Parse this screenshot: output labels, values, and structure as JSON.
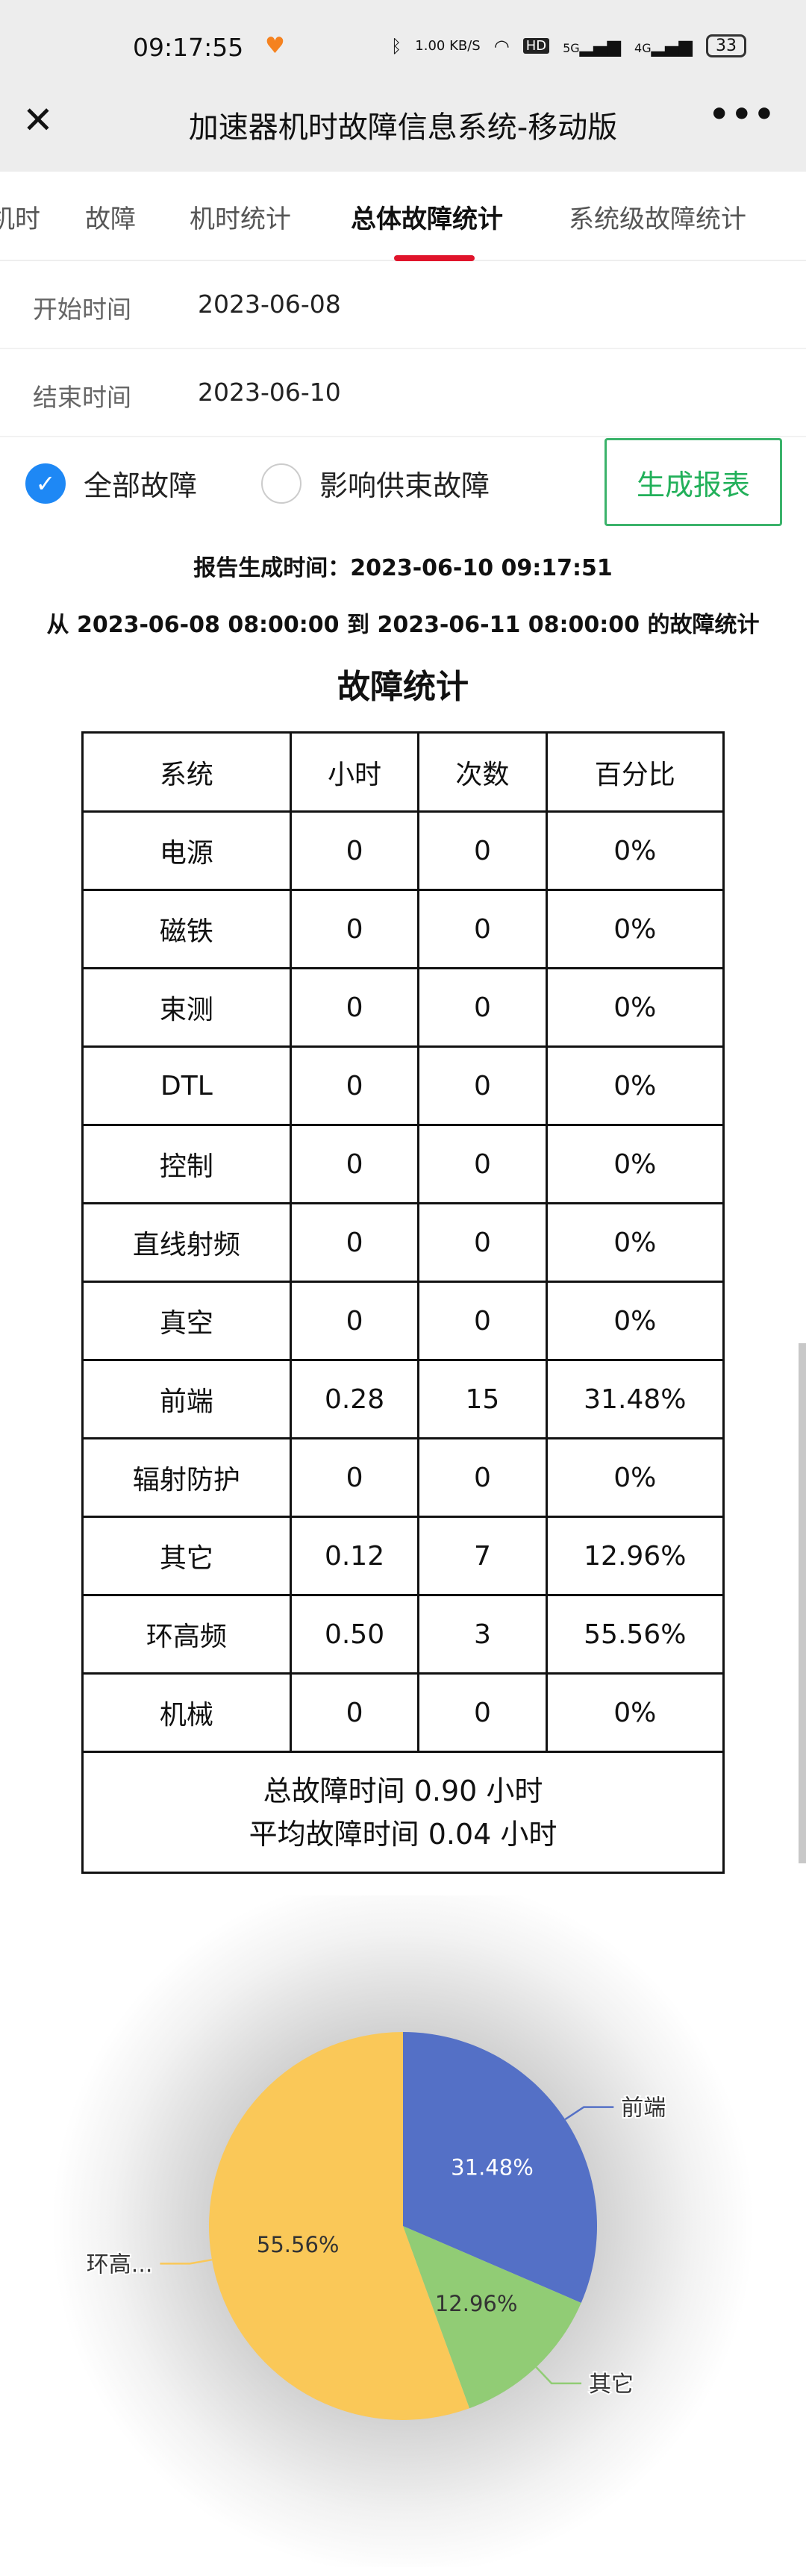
{
  "status_bar": {
    "time": "09:17:55",
    "net_speed": "1.00 KB/S",
    "network1": "5G",
    "network2": "4G",
    "battery": "33"
  },
  "header": {
    "title": "加速器机时故障信息系统-移动版"
  },
  "tabs": [
    {
      "label": "机时",
      "active": false
    },
    {
      "label": "故障",
      "active": false
    },
    {
      "label": "机时统计",
      "active": false
    },
    {
      "label": "总体故障统计",
      "active": true
    },
    {
      "label": "系统级故障统计",
      "active": false
    }
  ],
  "form": {
    "start_label": "开始时间",
    "start_value": "2023-06-08",
    "end_label": "结束时间",
    "end_value": "2023-06-10",
    "filter_all": "全部故障",
    "filter_all_checked": true,
    "filter_beam": "影响供束故障",
    "filter_beam_checked": false,
    "generate_button": "生成报表"
  },
  "report": {
    "generated_time": "报告生成时间：2023-06-10 09:17:51",
    "range": "从 2023-06-08 08:00:00 到 2023-06-11 08:00:00 的故障统计",
    "table_title": "故障统计"
  },
  "table": {
    "headers": [
      "系统",
      "小时",
      "次数",
      "百分比"
    ],
    "rows": [
      [
        "电源",
        "0",
        "0",
        "0%"
      ],
      [
        "磁铁",
        "0",
        "0",
        "0%"
      ],
      [
        "束测",
        "0",
        "0",
        "0%"
      ],
      [
        "DTL",
        "0",
        "0",
        "0%"
      ],
      [
        "控制",
        "0",
        "0",
        "0%"
      ],
      [
        "直线射频",
        "0",
        "0",
        "0%"
      ],
      [
        "真空",
        "0",
        "0",
        "0%"
      ],
      [
        "前端",
        "0.28",
        "15",
        "31.48%"
      ],
      [
        "辐射防护",
        "0",
        "0",
        "0%"
      ],
      [
        "其它",
        "0.12",
        "7",
        "12.96%"
      ],
      [
        "环高频",
        "0.50",
        "3",
        "55.56%"
      ],
      [
        "机械",
        "0",
        "0",
        "0%"
      ]
    ],
    "total": "总故障时间 0.90 小时",
    "average": "平均故障时间 0.04 小时"
  },
  "chart_data": {
    "type": "pie",
    "slices": [
      {
        "name": "前端",
        "label": "前端",
        "value": 31.48,
        "value_label": "31.48%",
        "color": "#5470c6",
        "text_color": "#ffffff"
      },
      {
        "name": "其它",
        "label": "其它",
        "value": 12.96,
        "value_label": "12.96%",
        "color": "#91cc75",
        "text_color": "#333333"
      },
      {
        "name": "环高频",
        "label": "环高...",
        "value": 55.56,
        "value_label": "55.56%",
        "color": "#fac858",
        "text_color": "#333333"
      }
    ],
    "start_angle": "top, clockwise"
  },
  "colors": {
    "accent_tab": "#e0142b",
    "button_green": "#22b05a",
    "radio_blue": "#1e88f5"
  }
}
